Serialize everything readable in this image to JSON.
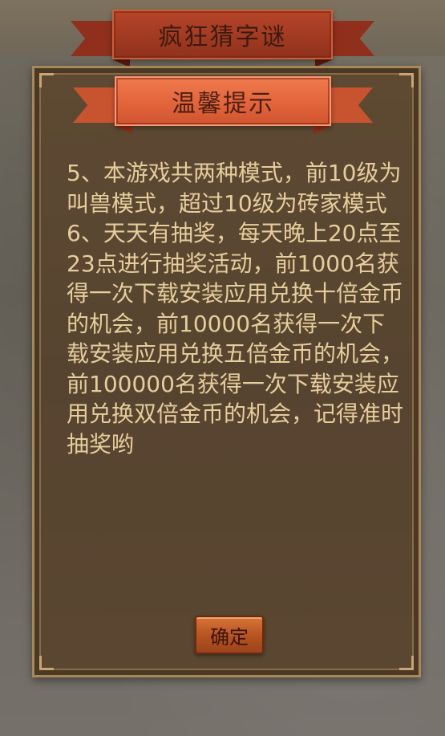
{
  "app": {
    "title": "疯狂猜字谜"
  },
  "dialog": {
    "header": "温馨提示",
    "body": "5、本游戏共两种模式，前10级为叫兽模式，超过10级为砖家模式\n6、天天有抽奖，每天晚上20点至23点进行抽奖活动，前1000名获得一次下载安装应用兑换十倍金币的机会，前10000名获得一次下载安装应用兑换五倍金币的机会，前100000名获得一次下载安装应用兑换双倍金币的机会，记得准时抽奖哟",
    "confirm_label": "确定"
  },
  "colors": {
    "title_ribbon": "#a23a22",
    "header_ribbon": "#e2643b",
    "panel": "#574430",
    "text": "#e6ce9c",
    "button": "#b85521"
  }
}
